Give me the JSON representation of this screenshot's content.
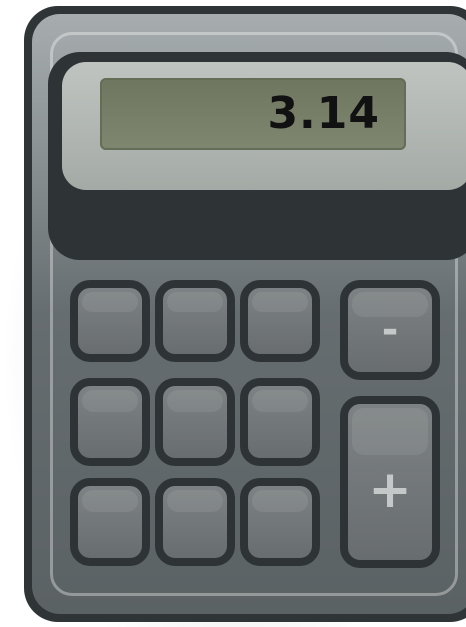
{
  "display": {
    "value": "3.14"
  },
  "keys": {
    "minus_label": "-",
    "plus_label": "+"
  }
}
